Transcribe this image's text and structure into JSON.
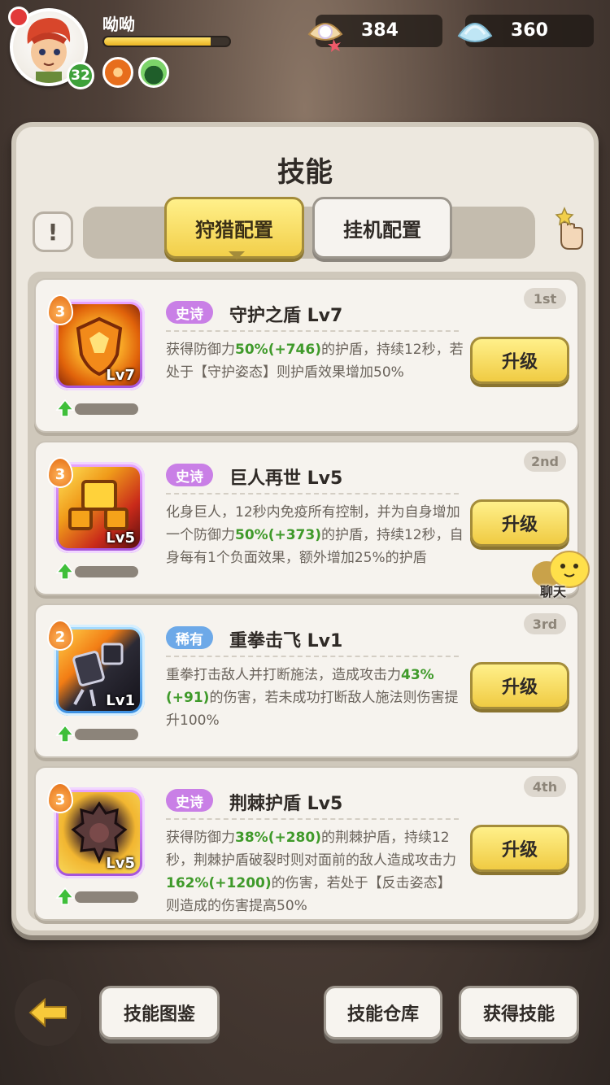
{
  "player": {
    "name": "呦呦",
    "level": "32",
    "exp_progress": 0.85
  },
  "currency": {
    "pearl": "384",
    "shell": "360"
  },
  "panel": {
    "title": "技能",
    "tabs": [
      "狩猎配置",
      "挂机配置"
    ],
    "active_tab": 0
  },
  "skills": [
    {
      "rank": "1st",
      "stars": "3",
      "rarity": "史诗",
      "name": "守护之盾 Lv7",
      "level_tag": "Lv7",
      "desc_parts": [
        "获得防御力",
        "50%(+746)",
        "的护盾，持续12秒，若处于【守护姿态】则护盾效果增加50%"
      ],
      "upgrade": "升级"
    },
    {
      "rank": "2nd",
      "stars": "3",
      "rarity": "史诗",
      "name": "巨人再世 Lv5",
      "level_tag": "Lv5",
      "desc_parts": [
        "化身巨人，12秒内免疫所有控制，并为自身增加一个防御力",
        "50%(+373)",
        "的护盾，持续12秒，自身每有1个负面效果，额外增加25%的护盾"
      ],
      "upgrade": "升级"
    },
    {
      "rank": "3rd",
      "stars": "2",
      "rarity": "稀有",
      "name": "重拳击飞 Lv1",
      "level_tag": "Lv1",
      "desc_parts": [
        "重拳打击敌人并打断施法，造成攻击力",
        "43%(+91)",
        "的伤害，若未成功打断敌人施法则伤害提升100%"
      ],
      "upgrade": "升级"
    },
    {
      "rank": "4th",
      "stars": "3",
      "rarity": "史诗",
      "name": "荆棘护盾 Lv5",
      "level_tag": "Lv5",
      "desc_parts": [
        "获得防御力",
        "38%(+280)",
        "的荆棘护盾，持续12秒，荆棘护盾破裂时则对面前的敌人造成攻击力",
        "162%(+1200)",
        "的伤害，若处于【反击姿态】则造成的伤害提高50%"
      ],
      "upgrade": "升级"
    }
  ],
  "chat": {
    "label": "聊天"
  },
  "bottom": {
    "codex": "技能图鉴",
    "warehouse": "技能仓库",
    "obtain": "获得技能"
  },
  "colors": {
    "accent_yellow": "#f0cb43",
    "highlight_green": "#3f9a2a",
    "epic_purple": "#c97fe6",
    "rare_blue": "#6da9e8"
  }
}
